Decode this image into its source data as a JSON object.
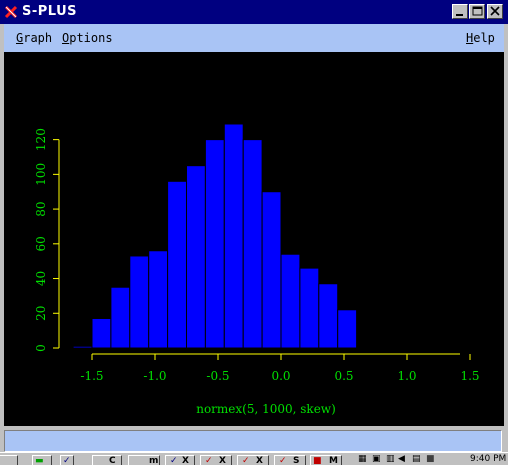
{
  "window": {
    "title": "S-PLUS"
  },
  "menu": {
    "graph": "Graph",
    "options": "Options",
    "help": "Help"
  },
  "chart_data": {
    "type": "bar",
    "xlabel": "normex(5, 1000, skew)",
    "ylabel": "",
    "xlim": [
      -1.5,
      1.5
    ],
    "ylim": [
      0,
      120
    ],
    "bin_width": 0.15,
    "bins": [
      -1.65,
      -1.5,
      -1.35,
      -1.2,
      -1.05,
      -0.9,
      -0.75,
      -0.6,
      -0.45,
      -0.3,
      -0.15,
      0.0,
      0.15,
      0.3,
      0.45,
      0.6,
      0.75,
      0.9,
      1.05
    ],
    "values": [
      1,
      17,
      35,
      53,
      56,
      96,
      105,
      120,
      129,
      120,
      90,
      54,
      46,
      37,
      22
    ],
    "x_ticks": [
      "-1.5",
      "-1.0",
      "-0.5",
      "0.0",
      "0.5",
      "1.0",
      "1.5"
    ],
    "x_tick_values": [
      -1.5,
      -1.0,
      -0.5,
      0.0,
      0.5,
      1.0,
      1.5
    ],
    "y_ticks": [
      "0",
      "20",
      "40",
      "60",
      "80",
      "100",
      "120"
    ],
    "y_tick_values": [
      0,
      20,
      40,
      60,
      80,
      100,
      120
    ],
    "bar_color": "#0000ff",
    "axis_color": "#ffff00",
    "label_color": "#00e000",
    "background": "#000000"
  },
  "taskbar": {
    "items": [
      "C",
      "m",
      "X",
      "X",
      "X",
      "S",
      "M"
    ],
    "clock": "9:40 PM"
  }
}
